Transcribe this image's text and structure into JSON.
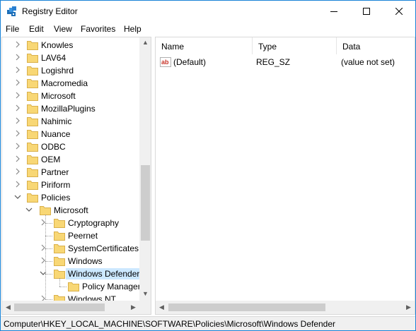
{
  "window": {
    "title": "Registry Editor"
  },
  "menu": [
    "File",
    "Edit",
    "View",
    "Favorites",
    "Help"
  ],
  "tree": [
    {
      "label": "Knowles",
      "arrow": ">",
      "level": 1
    },
    {
      "label": "LAV64",
      "arrow": ">",
      "level": 1
    },
    {
      "label": "Logishrd",
      "arrow": ">",
      "level": 1
    },
    {
      "label": "Macromedia",
      "arrow": ">",
      "level": 1
    },
    {
      "label": "Microsoft",
      "arrow": ">",
      "level": 1
    },
    {
      "label": "MozillaPlugins",
      "arrow": ">",
      "level": 1
    },
    {
      "label": "Nahimic",
      "arrow": ">",
      "level": 1
    },
    {
      "label": "Nuance",
      "arrow": ">",
      "level": 1
    },
    {
      "label": "ODBC",
      "arrow": ">",
      "level": 1
    },
    {
      "label": "OEM",
      "arrow": ">",
      "level": 1
    },
    {
      "label": "Partner",
      "arrow": ">",
      "level": 1
    },
    {
      "label": "Piriform",
      "arrow": ">",
      "level": 1
    },
    {
      "label": "Policies",
      "arrow": "v",
      "level": 1
    },
    {
      "label": "Microsoft",
      "arrow": "v",
      "level": 2
    },
    {
      "label": "Cryptography",
      "arrow": ">",
      "level": 3
    },
    {
      "label": "Peernet",
      "arrow": "",
      "level": 3
    },
    {
      "label": "SystemCertificates",
      "arrow": ">",
      "level": 3
    },
    {
      "label": "Windows",
      "arrow": ">",
      "level": 3
    },
    {
      "label": "Windows Defender",
      "arrow": "v",
      "level": 3,
      "selected": true
    },
    {
      "label": "Policy Manager",
      "arrow": "",
      "level": 4
    },
    {
      "label": "Windows NT",
      "arrow": ">",
      "level": 3
    }
  ],
  "list": {
    "columns": [
      "Name",
      "Type",
      "Data"
    ],
    "rows": [
      {
        "name": "(Default)",
        "type": "REG_SZ",
        "data": "(value not set)",
        "icon": "string-value-icon"
      }
    ]
  },
  "status": "Computer\\HKEY_LOCAL_MACHINE\\SOFTWARE\\Policies\\Microsoft\\Windows Defender",
  "colors": {
    "selection": "#cce8ff",
    "folder": "#f8d775",
    "border_accent": "#1883d7"
  }
}
